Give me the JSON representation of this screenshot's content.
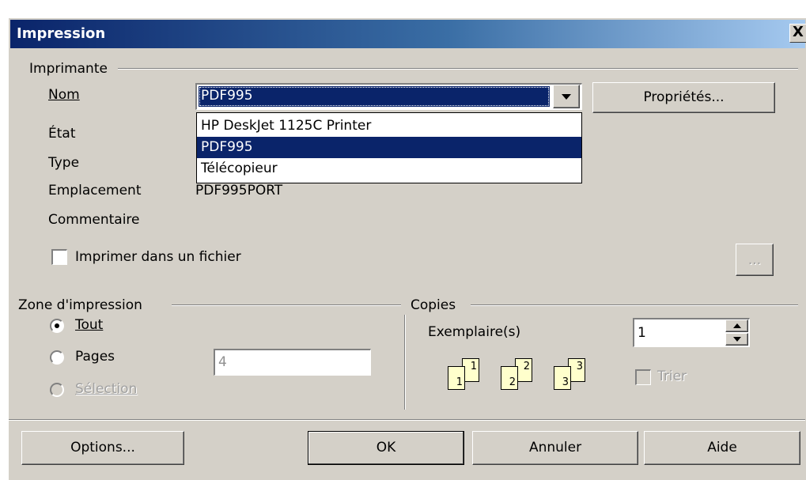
{
  "window": {
    "title": "Impression",
    "close_label": "X"
  },
  "printer": {
    "group_label": "Imprimante",
    "name_label": "Nom",
    "selected": "PDF995",
    "options": [
      "HP DeskJet 1125C Printer",
      "PDF995",
      "Télécopieur"
    ],
    "properties_button": "Propriétés...",
    "state_label": "État",
    "type_label": "Type",
    "location_label": "Emplacement",
    "location_value": "PDF995PORT",
    "comment_label": "Commentaire",
    "print_to_file_label": "Imprimer dans un fichier",
    "browse_button": "..."
  },
  "print_range": {
    "group_label": "Zone d'impression",
    "all_label": "Tout",
    "pages_label": "Pages",
    "pages_value": "4",
    "selection_label": "Sélection"
  },
  "copies": {
    "group_label": "Copies",
    "count_label": "Exemplaire(s)",
    "count_value": "1",
    "collate_label": "Trier",
    "page_numbers": [
      "1",
      "1",
      "2",
      "2",
      "3",
      "3"
    ]
  },
  "buttons": {
    "options": "Options...",
    "ok": "OK",
    "cancel": "Annuler",
    "help": "Aide"
  },
  "colors": {
    "title_bar": "#0a246a",
    "selection": "#0a246a",
    "dialog_bg": "#d4d0c8"
  }
}
